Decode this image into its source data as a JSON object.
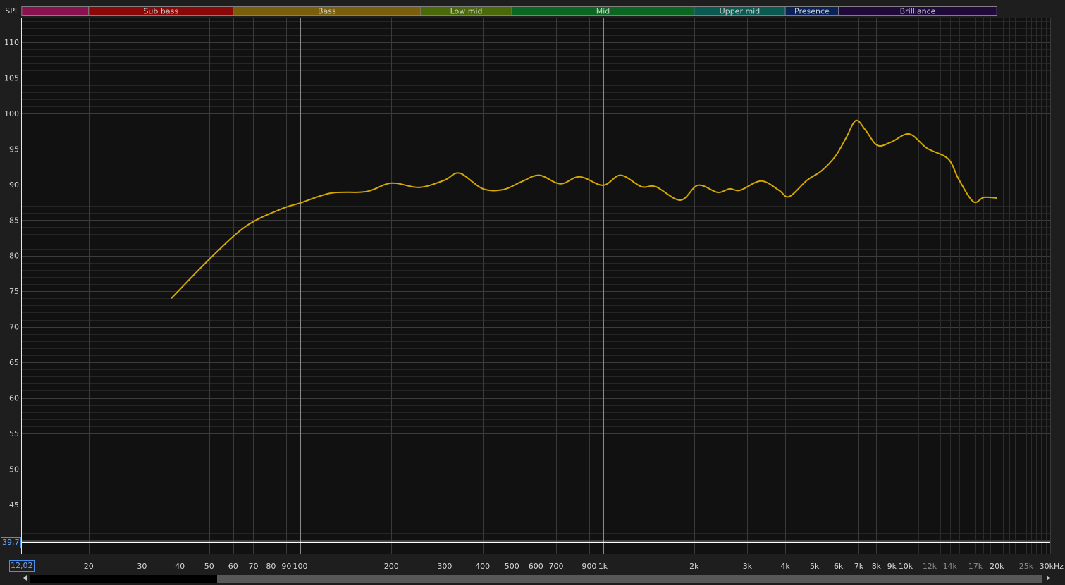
{
  "chart_data": {
    "type": "line",
    "title": "",
    "ylabel": "SPL",
    "xlabel": "",
    "x_unit": "kHz",
    "xscale": "log",
    "xlim": [
      12.02,
      30000
    ],
    "ylim": [
      39.7,
      113.5
    ],
    "grid": true,
    "y_ticks": [
      110,
      105,
      100,
      95,
      90,
      85,
      80,
      75,
      70,
      65,
      60,
      55,
      50,
      45
    ],
    "x_ticks": [
      {
        "value": 20,
        "label": "20"
      },
      {
        "value": 30,
        "label": "30"
      },
      {
        "value": 40,
        "label": "40"
      },
      {
        "value": 50,
        "label": "50"
      },
      {
        "value": 60,
        "label": "60"
      },
      {
        "value": 70,
        "label": "70"
      },
      {
        "value": 80,
        "label": "80"
      },
      {
        "value": 90,
        "label": "90"
      },
      {
        "value": 100,
        "label": "100"
      },
      {
        "value": 200,
        "label": "200"
      },
      {
        "value": 300,
        "label": "300"
      },
      {
        "value": 400,
        "label": "400"
      },
      {
        "value": 500,
        "label": "500"
      },
      {
        "value": 600,
        "label": "600"
      },
      {
        "value": 700,
        "label": "700"
      },
      {
        "value": 900,
        "label": "900"
      },
      {
        "value": 1000,
        "label": "1k"
      },
      {
        "value": 2000,
        "label": "2k"
      },
      {
        "value": 3000,
        "label": "3k"
      },
      {
        "value": 4000,
        "label": "4k"
      },
      {
        "value": 5000,
        "label": "5k"
      },
      {
        "value": 6000,
        "label": "6k"
      },
      {
        "value": 7000,
        "label": "7k"
      },
      {
        "value": 8000,
        "label": "8k"
      },
      {
        "value": 9000,
        "label": "9k"
      },
      {
        "value": 10000,
        "label": "10k"
      },
      {
        "value": 12000,
        "label": "12k",
        "dim": true
      },
      {
        "value": 14000,
        "label": "14k",
        "dim": true
      },
      {
        "value": 17000,
        "label": "17k",
        "dim": true
      },
      {
        "value": 20000,
        "label": "20k"
      },
      {
        "value": 25000,
        "label": "25k",
        "dim": true
      },
      {
        "value": 30000,
        "label": "30kHz"
      }
    ],
    "bands": [
      {
        "label": "",
        "from": 12.02,
        "to": 20,
        "color": "#8a1150"
      },
      {
        "label": "Sub bass",
        "from": 20,
        "to": 60,
        "color": "#8a0808"
      },
      {
        "label": "Bass",
        "from": 60,
        "to": 250,
        "color": "#7a5e0a"
      },
      {
        "label": "Low mid",
        "from": 250,
        "to": 500,
        "color": "#4a6a0a"
      },
      {
        "label": "Mid",
        "from": 500,
        "to": 2000,
        "color": "#0a6620"
      },
      {
        "label": "Upper mid",
        "from": 2000,
        "to": 4000,
        "color": "#0a5a52"
      },
      {
        "label": "Presence",
        "from": 4000,
        "to": 6000,
        "color": "#0a2258"
      },
      {
        "label": "Brilliance",
        "from": 6000,
        "to": 20000,
        "color": "#200a3c"
      }
    ],
    "series": [
      {
        "name": "SPL",
        "color": "#d4a800",
        "x": [
          37.5,
          50.9,
          66.5,
          87,
          100,
          126.6,
          165,
          200,
          247,
          299,
          336,
          401,
          470,
          538,
          616,
          723,
          837,
          1000,
          1144,
          1340,
          1493,
          1800,
          2060,
          2390,
          2620,
          2840,
          3330,
          3810,
          4120,
          4720,
          5260,
          5860,
          6360,
          6850,
          7380,
          8070,
          8980,
          10270,
          11760,
          13810,
          14980,
          16720,
          18130,
          20000
        ],
        "y": [
          74.0,
          79.8,
          84.2,
          86.6,
          87.4,
          88.8,
          89.0,
          90.2,
          89.6,
          90.6,
          91.6,
          89.4,
          89.3,
          90.4,
          91.3,
          90.1,
          91.1,
          89.9,
          91.3,
          89.7,
          89.7,
          87.8,
          89.9,
          88.9,
          89.4,
          89.2,
          90.5,
          89.2,
          88.3,
          90.6,
          91.9,
          94.0,
          96.6,
          99.0,
          97.6,
          95.5,
          96.0,
          97.1,
          95.1,
          93.6,
          90.7,
          87.6,
          88.2,
          88.1
        ]
      }
    ],
    "cursor": {
      "x_label": "12,02",
      "y_label": "39,7",
      "y_value": 39.7
    }
  }
}
